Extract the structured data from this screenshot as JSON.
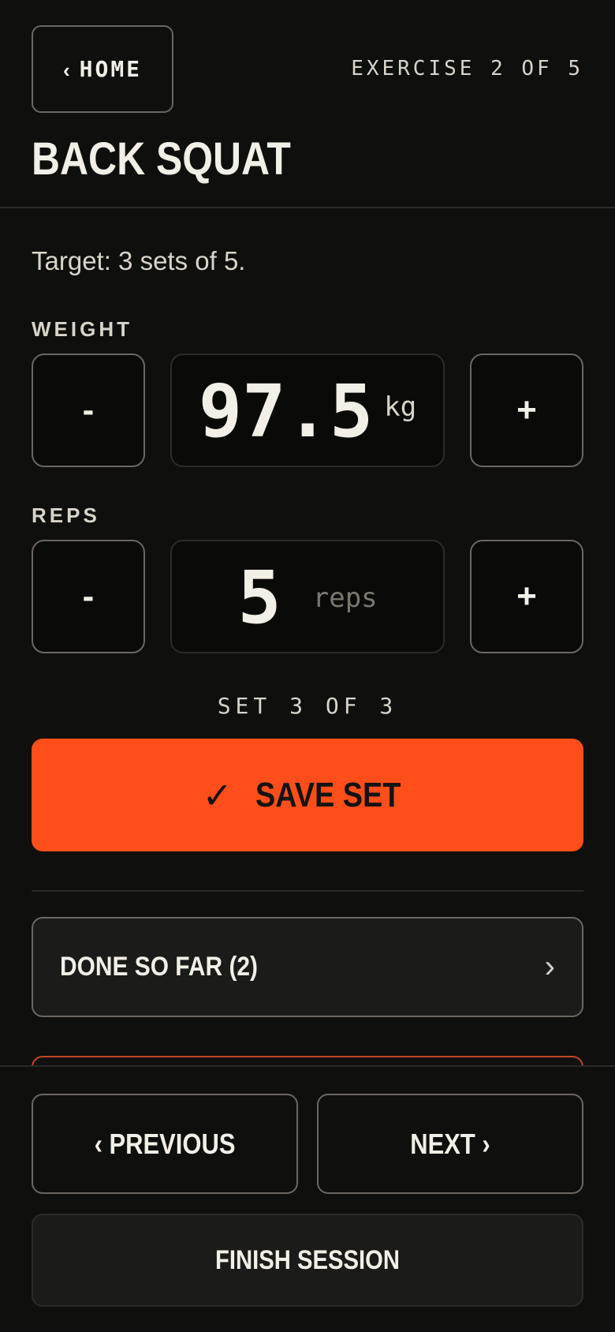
{
  "header": {
    "home_chevron": "‹",
    "home_label": "HOME",
    "exercise_count": "EXERCISE 2 OF 5",
    "title": "BACK SQUAT"
  },
  "target": "Target: 3 sets of 5.",
  "weight": {
    "label": "WEIGHT",
    "minus": "-",
    "plus": "+",
    "value": "97.5",
    "unit": "kg"
  },
  "reps": {
    "label": "REPS",
    "minus": "-",
    "plus": "+",
    "value": "5",
    "unit": "reps"
  },
  "set_indicator": "SET 3 OF 3",
  "save": {
    "icon": "✓",
    "label": "SAVE SET"
  },
  "done": {
    "label": "DONE SO FAR (2)",
    "chevron": "›"
  },
  "nav": {
    "previous_label": "‹ PREVIOUS",
    "next_label": "NEXT ›",
    "finish_label": "FINISH SESSION"
  },
  "colors": {
    "background": "#0f0f0e",
    "accent": "#ff4e1a",
    "border": "#6b6760",
    "text": "#f2efe6"
  }
}
